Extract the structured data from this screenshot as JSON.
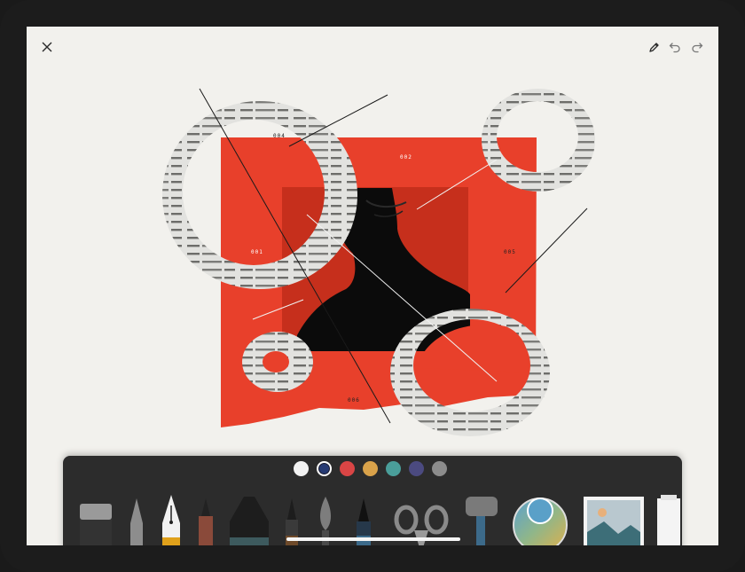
{
  "toolbar": {
    "close_icon": "close-icon",
    "pen_icon": "pencil-icon",
    "undo_icon": "undo-icon",
    "redo_icon": "redo-icon"
  },
  "artwork": {
    "labels": [
      "004",
      "002",
      "001",
      "005",
      "006"
    ],
    "colors": {
      "red": "#e8402b",
      "dark_red": "#c9301f",
      "paper": "#dcdcda",
      "black": "#0a0a0a"
    }
  },
  "palette": {
    "selected_index": 1,
    "colors": [
      "#f2f2f2",
      "#263a73",
      "#d94545",
      "#d9a24a",
      "#4a9e9a",
      "#4b4a80",
      "#8c8c8c"
    ]
  },
  "tools": [
    "eraser",
    "pencil",
    "fountain-pen",
    "brush-pen",
    "marker",
    "fineliner",
    "watercolor-brush",
    "ink-pen",
    "scissors",
    "roller",
    "color-picker",
    "image",
    "canvas-roll"
  ]
}
